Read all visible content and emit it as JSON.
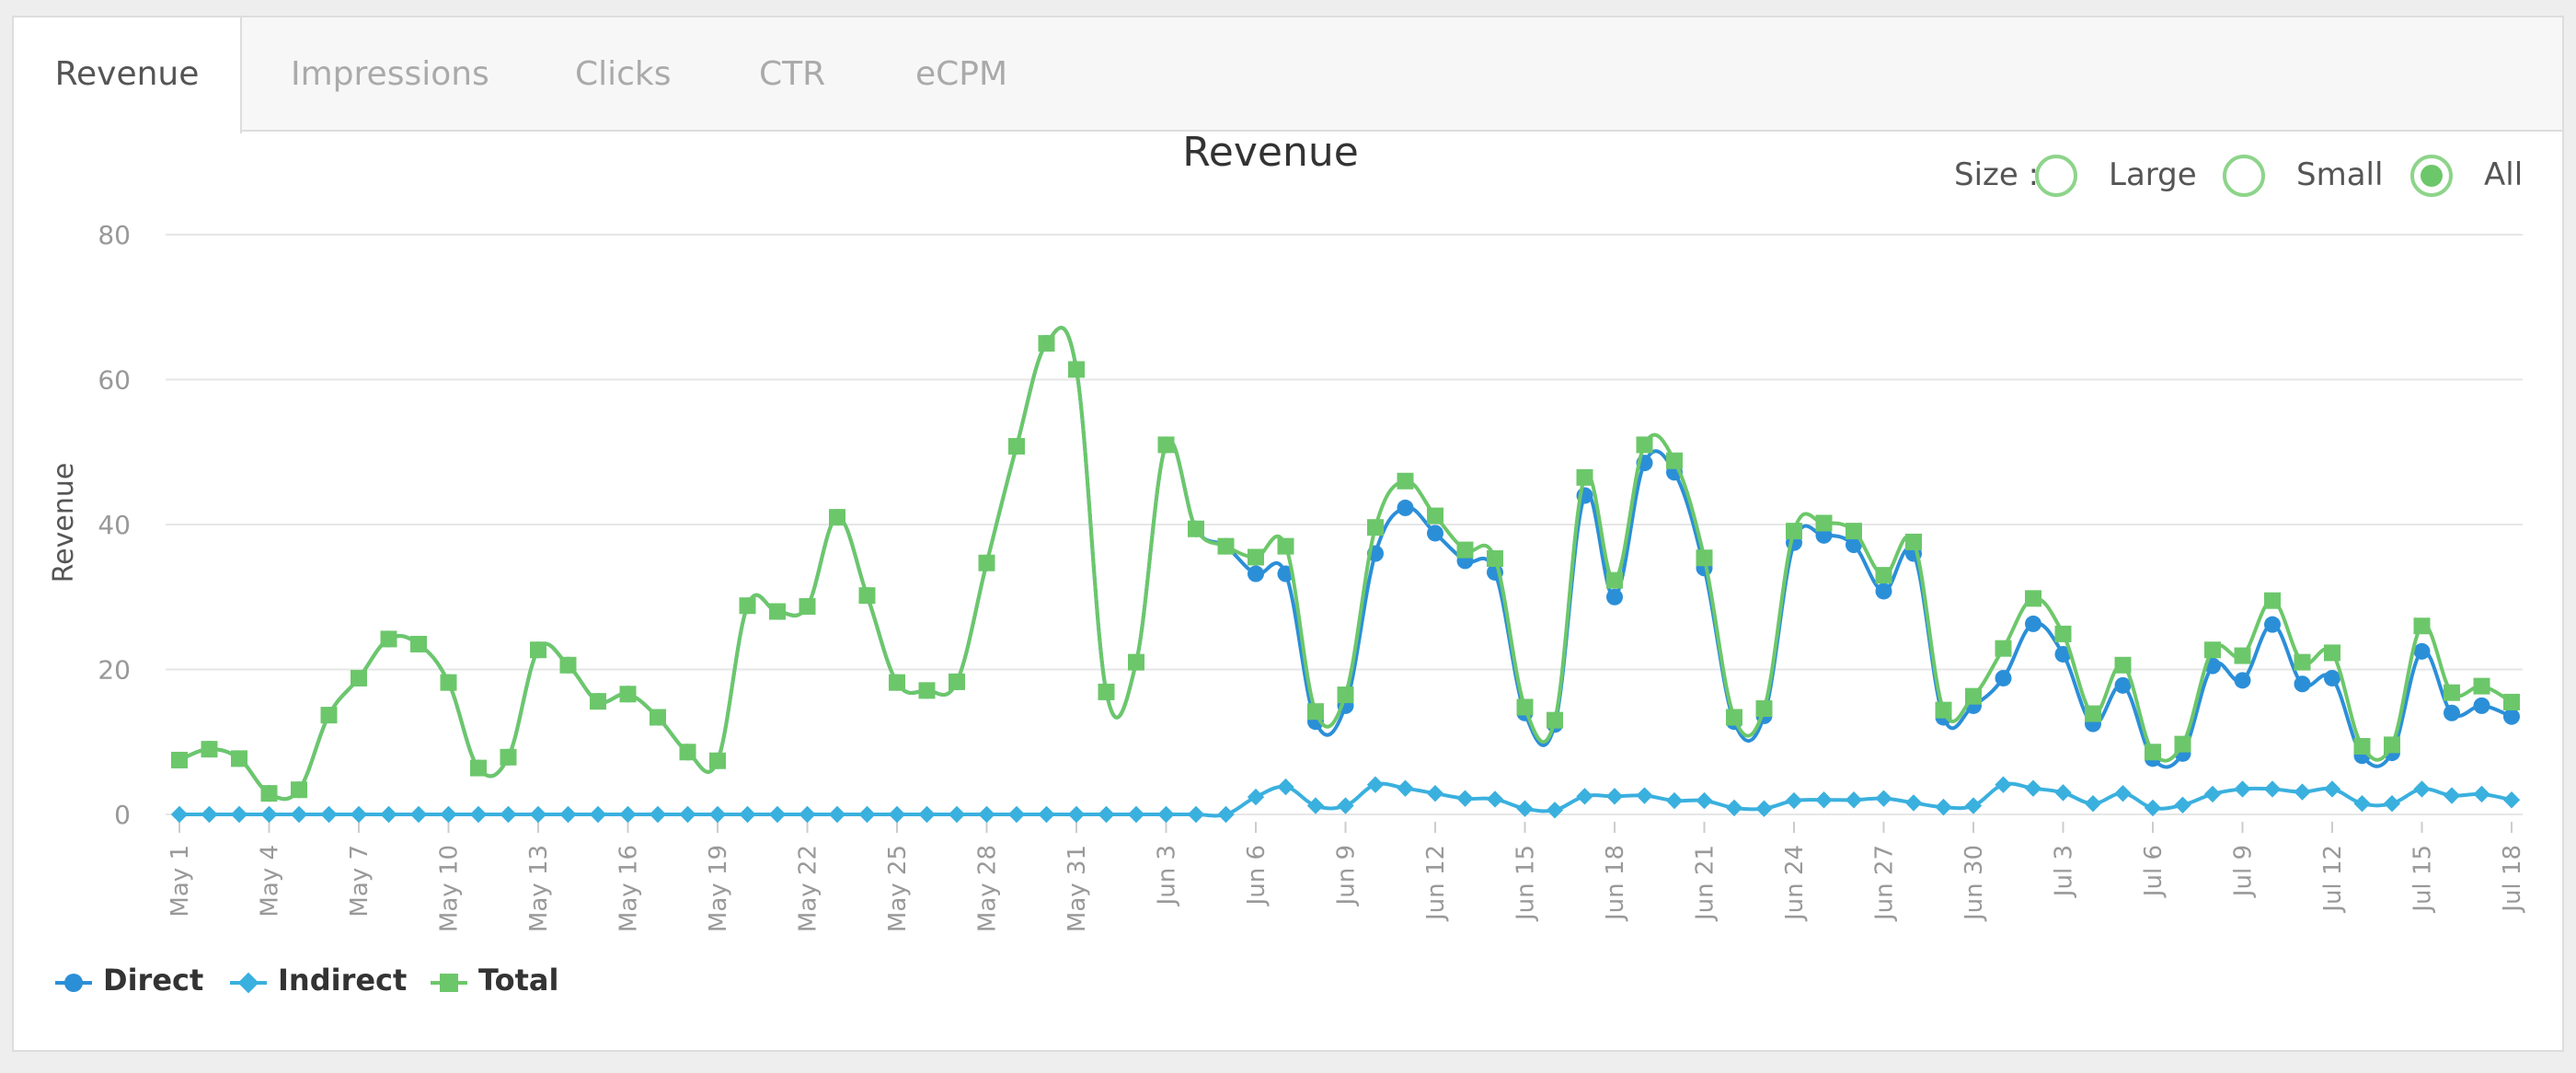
{
  "tabs": [
    "Revenue",
    "Impressions",
    "Clicks",
    "CTR",
    "eCPM"
  ],
  "size_filter": {
    "label": "Size :",
    "options": [
      "Large",
      "Small",
      "All"
    ],
    "selected": "All"
  },
  "colors": {
    "direct": "#2b8fd8",
    "indirect": "#3ab0de",
    "total": "#6cc76a",
    "grid": "#e6e6e6",
    "tick": "#999999"
  },
  "chart_data": {
    "type": "line",
    "title": "Revenue",
    "ylabel": "Revenue",
    "xlabel": "",
    "ylim": [
      0,
      80
    ],
    "yticks": [
      0,
      20,
      40,
      60,
      80
    ],
    "grid": true,
    "legend_position": "bottom-left",
    "x": [
      "May 1",
      "May 2",
      "May 3",
      "May 4",
      "May 5",
      "May 6",
      "May 7",
      "May 8",
      "May 9",
      "May 10",
      "May 11",
      "May 12",
      "May 13",
      "May 14",
      "May 15",
      "May 16",
      "May 17",
      "May 18",
      "May 19",
      "May 20",
      "May 21",
      "May 22",
      "May 23",
      "May 24",
      "May 25",
      "May 26",
      "May 27",
      "May 28",
      "May 29",
      "May 30",
      "May 31",
      "Jun 1",
      "Jun 2",
      "Jun 3",
      "Jun 4",
      "Jun 5",
      "Jun 6",
      "Jun 7",
      "Jun 8",
      "Jun 9",
      "Jun 10",
      "Jun 11",
      "Jun 12",
      "Jun 13",
      "Jun 14",
      "Jun 15",
      "Jun 16",
      "Jun 17",
      "Jun 18",
      "Jun 19",
      "Jun 20",
      "Jun 21",
      "Jun 22",
      "Jun 23",
      "Jun 24",
      "Jun 25",
      "Jun 26",
      "Jun 27",
      "Jun 28",
      "Jun 29",
      "Jun 30",
      "Jul 1",
      "Jul 2",
      "Jul 3",
      "Jul 4",
      "Jul 5",
      "Jul 6",
      "Jul 7",
      "Jul 8",
      "Jul 9",
      "Jul 10",
      "Jul 11",
      "Jul 12",
      "Jul 13",
      "Jul 14",
      "Jul 15",
      "Jul 16",
      "Jul 17",
      "Jul 18"
    ],
    "xtick_labels": [
      "May 1",
      "May 4",
      "May 7",
      "May 10",
      "May 13",
      "May 16",
      "May 19",
      "May 22",
      "May 25",
      "May 28",
      "May 31",
      "Jun 3",
      "Jun 6",
      "Jun 9",
      "Jun 12",
      "Jun 15",
      "Jun 18",
      "Jun 21",
      "Jun 24",
      "Jun 27",
      "Jun 30",
      "Jul 3",
      "Jul 6",
      "Jul 9",
      "Jul 12",
      "Jul 15",
      "Jul 18"
    ],
    "series": [
      {
        "name": "Direct",
        "marker": "circle",
        "values": [
          7.5,
          9.0,
          7.7,
          2.9,
          3.4,
          13.7,
          18.8,
          24.2,
          23.5,
          18.2,
          6.4,
          7.9,
          22.7,
          20.6,
          15.6,
          16.6,
          13.4,
          8.6,
          7.4,
          28.8,
          28.0,
          28.7,
          41.0,
          30.2,
          18.2,
          17.1,
          18.3,
          34.7,
          50.8,
          65.0,
          61.4,
          16.9,
          21.0,
          51.0,
          39.4,
          37.0,
          33.2,
          33.2,
          12.8,
          15.0,
          36.0,
          42.3,
          38.8,
          35.0,
          33.4,
          14.0,
          12.4,
          44.0,
          30.0,
          48.5,
          47.2,
          34.0,
          12.8,
          13.6,
          37.5,
          38.5,
          37.2,
          30.8,
          36.0,
          13.4,
          15.0,
          18.8,
          26.3,
          22.1,
          12.5,
          17.8,
          7.7,
          8.4,
          20.5,
          18.5,
          26.2,
          18.0,
          18.8,
          8.1,
          8.5,
          22.5,
          14.0,
          15.0,
          13.5
        ]
      },
      {
        "name": "Indirect",
        "marker": "diamond",
        "values": [
          0,
          0,
          0,
          0,
          0,
          0,
          0,
          0,
          0,
          0,
          0,
          0,
          0,
          0,
          0,
          0,
          0,
          0,
          0,
          0,
          0,
          0,
          0,
          0,
          0,
          0,
          0,
          0,
          0,
          0,
          0,
          0,
          0,
          0,
          0,
          0,
          2.4,
          3.8,
          1.2,
          1.2,
          4.1,
          3.6,
          2.9,
          2.2,
          2.1,
          0.8,
          0.6,
          2.5,
          2.5,
          2.6,
          1.9,
          1.9,
          0.9,
          0.8,
          1.9,
          2.0,
          2.0,
          2.2,
          1.6,
          1.0,
          1.2,
          4.1,
          3.6,
          3.0,
          1.5,
          2.9,
          0.9,
          1.3,
          2.8,
          3.5,
          3.5,
          3.1,
          3.5,
          1.5,
          1.5,
          3.5,
          2.6,
          2.8,
          2.0
        ]
      },
      {
        "name": "Total",
        "marker": "square",
        "values": [
          7.5,
          9.0,
          7.7,
          2.9,
          3.4,
          13.7,
          18.8,
          24.2,
          23.5,
          18.2,
          6.4,
          7.9,
          22.7,
          20.6,
          15.6,
          16.6,
          13.4,
          8.6,
          7.4,
          28.8,
          28.0,
          28.7,
          41.0,
          30.2,
          18.2,
          17.1,
          18.3,
          34.7,
          50.8,
          65.0,
          61.4,
          16.9,
          21.0,
          51.0,
          39.4,
          37.0,
          35.5,
          37.0,
          14.2,
          16.5,
          39.6,
          46.0,
          41.2,
          36.5,
          35.3,
          14.8,
          13.0,
          46.5,
          32.3,
          51.0,
          48.8,
          35.4,
          13.4,
          14.6,
          39.1,
          40.2,
          39.1,
          33.0,
          37.6,
          14.4,
          16.3,
          22.9,
          29.8,
          24.9,
          13.9,
          20.6,
          8.6,
          9.7,
          22.7,
          21.9,
          29.5,
          21.0,
          22.3,
          9.4,
          9.6,
          26.0,
          16.8,
          17.7,
          15.5
        ]
      }
    ]
  }
}
